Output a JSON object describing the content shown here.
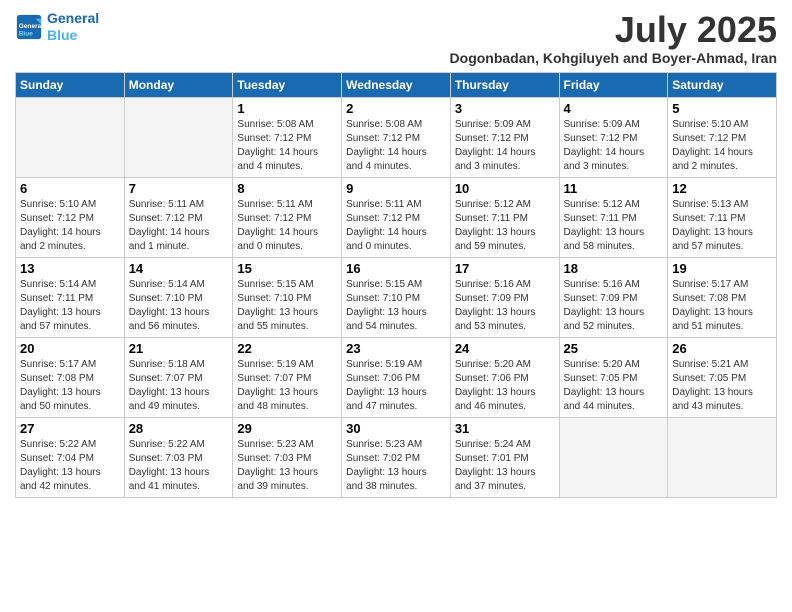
{
  "logo": {
    "line1": "General",
    "line2": "Blue"
  },
  "title": "July 2025",
  "subtitle": "Dogonbadan, Kohgiluyeh and Boyer-Ahmad, Iran",
  "headers": [
    "Sunday",
    "Monday",
    "Tuesday",
    "Wednesday",
    "Thursday",
    "Friday",
    "Saturday"
  ],
  "weeks": [
    [
      {
        "day": "",
        "info": ""
      },
      {
        "day": "",
        "info": ""
      },
      {
        "day": "1",
        "info": "Sunrise: 5:08 AM\nSunset: 7:12 PM\nDaylight: 14 hours and 4 minutes."
      },
      {
        "day": "2",
        "info": "Sunrise: 5:08 AM\nSunset: 7:12 PM\nDaylight: 14 hours and 4 minutes."
      },
      {
        "day": "3",
        "info": "Sunrise: 5:09 AM\nSunset: 7:12 PM\nDaylight: 14 hours and 3 minutes."
      },
      {
        "day": "4",
        "info": "Sunrise: 5:09 AM\nSunset: 7:12 PM\nDaylight: 14 hours and 3 minutes."
      },
      {
        "day": "5",
        "info": "Sunrise: 5:10 AM\nSunset: 7:12 PM\nDaylight: 14 hours and 2 minutes."
      }
    ],
    [
      {
        "day": "6",
        "info": "Sunrise: 5:10 AM\nSunset: 7:12 PM\nDaylight: 14 hours and 2 minutes."
      },
      {
        "day": "7",
        "info": "Sunrise: 5:11 AM\nSunset: 7:12 PM\nDaylight: 14 hours and 1 minute."
      },
      {
        "day": "8",
        "info": "Sunrise: 5:11 AM\nSunset: 7:12 PM\nDaylight: 14 hours and 0 minutes."
      },
      {
        "day": "9",
        "info": "Sunrise: 5:11 AM\nSunset: 7:12 PM\nDaylight: 14 hours and 0 minutes."
      },
      {
        "day": "10",
        "info": "Sunrise: 5:12 AM\nSunset: 7:11 PM\nDaylight: 13 hours and 59 minutes."
      },
      {
        "day": "11",
        "info": "Sunrise: 5:12 AM\nSunset: 7:11 PM\nDaylight: 13 hours and 58 minutes."
      },
      {
        "day": "12",
        "info": "Sunrise: 5:13 AM\nSunset: 7:11 PM\nDaylight: 13 hours and 57 minutes."
      }
    ],
    [
      {
        "day": "13",
        "info": "Sunrise: 5:14 AM\nSunset: 7:11 PM\nDaylight: 13 hours and 57 minutes."
      },
      {
        "day": "14",
        "info": "Sunrise: 5:14 AM\nSunset: 7:10 PM\nDaylight: 13 hours and 56 minutes."
      },
      {
        "day": "15",
        "info": "Sunrise: 5:15 AM\nSunset: 7:10 PM\nDaylight: 13 hours and 55 minutes."
      },
      {
        "day": "16",
        "info": "Sunrise: 5:15 AM\nSunset: 7:10 PM\nDaylight: 13 hours and 54 minutes."
      },
      {
        "day": "17",
        "info": "Sunrise: 5:16 AM\nSunset: 7:09 PM\nDaylight: 13 hours and 53 minutes."
      },
      {
        "day": "18",
        "info": "Sunrise: 5:16 AM\nSunset: 7:09 PM\nDaylight: 13 hours and 52 minutes."
      },
      {
        "day": "19",
        "info": "Sunrise: 5:17 AM\nSunset: 7:08 PM\nDaylight: 13 hours and 51 minutes."
      }
    ],
    [
      {
        "day": "20",
        "info": "Sunrise: 5:17 AM\nSunset: 7:08 PM\nDaylight: 13 hours and 50 minutes."
      },
      {
        "day": "21",
        "info": "Sunrise: 5:18 AM\nSunset: 7:07 PM\nDaylight: 13 hours and 49 minutes."
      },
      {
        "day": "22",
        "info": "Sunrise: 5:19 AM\nSunset: 7:07 PM\nDaylight: 13 hours and 48 minutes."
      },
      {
        "day": "23",
        "info": "Sunrise: 5:19 AM\nSunset: 7:06 PM\nDaylight: 13 hours and 47 minutes."
      },
      {
        "day": "24",
        "info": "Sunrise: 5:20 AM\nSunset: 7:06 PM\nDaylight: 13 hours and 46 minutes."
      },
      {
        "day": "25",
        "info": "Sunrise: 5:20 AM\nSunset: 7:05 PM\nDaylight: 13 hours and 44 minutes."
      },
      {
        "day": "26",
        "info": "Sunrise: 5:21 AM\nSunset: 7:05 PM\nDaylight: 13 hours and 43 minutes."
      }
    ],
    [
      {
        "day": "27",
        "info": "Sunrise: 5:22 AM\nSunset: 7:04 PM\nDaylight: 13 hours and 42 minutes."
      },
      {
        "day": "28",
        "info": "Sunrise: 5:22 AM\nSunset: 7:03 PM\nDaylight: 13 hours and 41 minutes."
      },
      {
        "day": "29",
        "info": "Sunrise: 5:23 AM\nSunset: 7:03 PM\nDaylight: 13 hours and 39 minutes."
      },
      {
        "day": "30",
        "info": "Sunrise: 5:23 AM\nSunset: 7:02 PM\nDaylight: 13 hours and 38 minutes."
      },
      {
        "day": "31",
        "info": "Sunrise: 5:24 AM\nSunset: 7:01 PM\nDaylight: 13 hours and 37 minutes."
      },
      {
        "day": "",
        "info": ""
      },
      {
        "day": "",
        "info": ""
      }
    ]
  ]
}
